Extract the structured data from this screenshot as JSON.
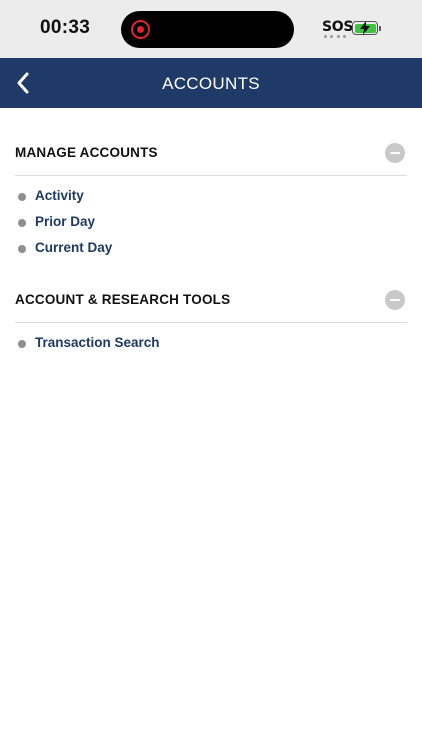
{
  "status_bar": {
    "time": "00:33",
    "sos": "SOS",
    "recording_color": "#e0242c",
    "battery_color": "#3ec43e"
  },
  "nav": {
    "title": "ACCOUNTS",
    "back_icon": "chevron-left-icon",
    "background": "#1f3a66"
  },
  "sections": [
    {
      "title": "MANAGE ACCOUNTS",
      "collapse_icon": "minus-circle-icon",
      "items": [
        "Activity",
        "Prior Day",
        "Current Day"
      ]
    },
    {
      "title": "ACCOUNT & RESEARCH TOOLS",
      "collapse_icon": "minus-circle-icon",
      "items": [
        "Transaction Search"
      ]
    }
  ]
}
